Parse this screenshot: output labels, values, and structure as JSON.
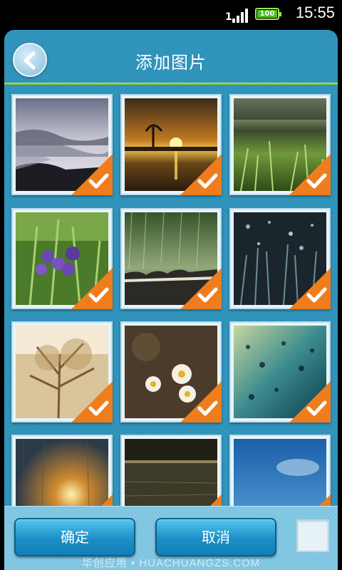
{
  "status_bar": {
    "time": "15:55",
    "battery_label": "100",
    "battery_level": 1.0,
    "signal_label": "1"
  },
  "header": {
    "title": "添加图片",
    "back_icon": "back-arrow-icon"
  },
  "images": [
    {
      "name": "misty-mountains",
      "selected": true
    },
    {
      "name": "sunset-rain",
      "selected": true
    },
    {
      "name": "dewy-grass",
      "selected": true
    },
    {
      "name": "purple-flowers",
      "selected": true
    },
    {
      "name": "rain-on-roof",
      "selected": true
    },
    {
      "name": "dark-grass-dew",
      "selected": true
    },
    {
      "name": "sepia-trees",
      "selected": true
    },
    {
      "name": "daisies-rain",
      "selected": true
    },
    {
      "name": "droplets-glass",
      "selected": true
    },
    {
      "name": "rain-window-sunset",
      "selected": true
    },
    {
      "name": "rain-lake",
      "selected": true
    },
    {
      "name": "blue-sky-drops",
      "selected": true
    }
  ],
  "footer": {
    "confirm_label": "确定",
    "cancel_label": "取消",
    "watermark": "华创应用 • HUACHUANGZS.COM"
  },
  "colors": {
    "accent": "#1b8fc6",
    "check_orange": "#ef7d1d",
    "panel_blue": "#3398bf"
  }
}
